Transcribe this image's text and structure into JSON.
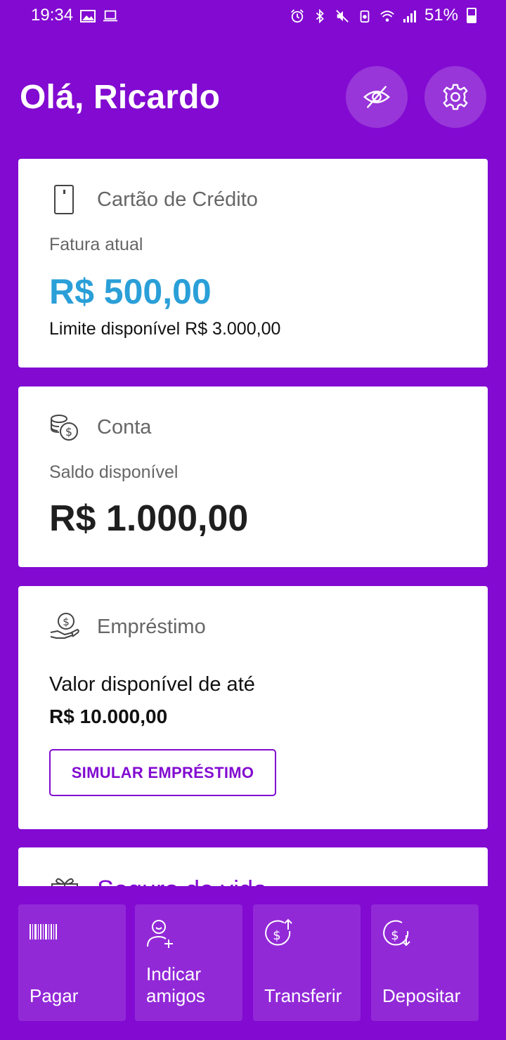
{
  "status_bar": {
    "time": "19:34",
    "battery": "51%",
    "icons": [
      "gallery-icon",
      "laptop-icon",
      "alarm-icon",
      "bluetooth-icon",
      "mute-icon",
      "data-saver-icon",
      "wifi-icon",
      "signal-icon",
      "battery-icon"
    ]
  },
  "header": {
    "greeting": "Olá, Ricardo",
    "actions": [
      "hide-eye-icon",
      "settings-gear-icon"
    ]
  },
  "credit_card": {
    "title": "Cartão de Crédito",
    "label": "Fatura atual",
    "amount": "R$ 500,00",
    "limit_text": "Limite disponível R$ 3.000,00",
    "icon": "phone-card-icon"
  },
  "account": {
    "title": "Conta",
    "label": "Saldo disponível",
    "amount": "R$ 1.000,00",
    "icon": "coins-icon"
  },
  "loan": {
    "title": "Empréstimo",
    "line1": "Valor disponível de até",
    "amount": "R$ 10.000,00",
    "button": "SIMULAR EMPRÉSTIMO",
    "icon": "hand-money-icon"
  },
  "insurance": {
    "title": "Seguro de vida",
    "icon": "gift-icon"
  },
  "actions": [
    {
      "label": "Pagar",
      "icon": "barcode-icon"
    },
    {
      "label": "Indicar\namigos",
      "icon": "add-person-icon"
    },
    {
      "label": "Transferir",
      "icon": "money-out-icon"
    },
    {
      "label": "Depositar",
      "icon": "money-in-icon"
    }
  ],
  "colors": {
    "brand_purple": "#820ad1",
    "invoice_blue": "#2a9fd8"
  }
}
